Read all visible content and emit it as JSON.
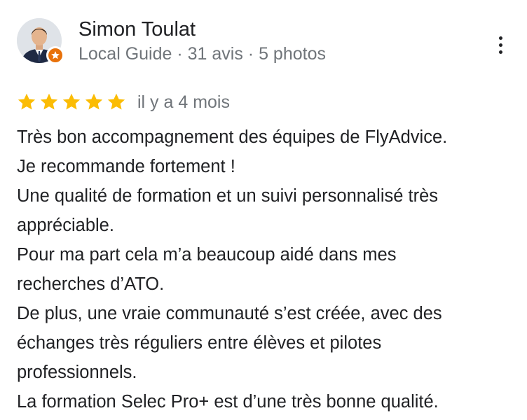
{
  "reviewer": {
    "name": "Simon Toulat",
    "meta": "Local Guide · 31 avis · 5 photos",
    "avatar_icon": "person-avatar",
    "badge_icon": "local-guide-star-icon",
    "badge_color": "#e8710a"
  },
  "menu": {
    "icon": "more-vertical-icon"
  },
  "rating": {
    "stars": 5,
    "max": 5,
    "star_color": "#fbbc04",
    "date": "il y a 4 mois"
  },
  "review": {
    "lines": [
      "Très bon accompagnement des équipes de FlyAdvice.",
      "Je recommande fortement !",
      "Une qualité de formation et un suivi personnalisé très",
      "appréciable.",
      "Pour ma part cela m’a beaucoup aidé dans mes",
      "recherches d’ATO.",
      "De plus, une vraie communauté s’est créée, avec des",
      "échanges très réguliers entre élèves et pilotes",
      "professionnels.",
      "La formation Selec Pro+ est d’une très bonne qualité."
    ]
  }
}
